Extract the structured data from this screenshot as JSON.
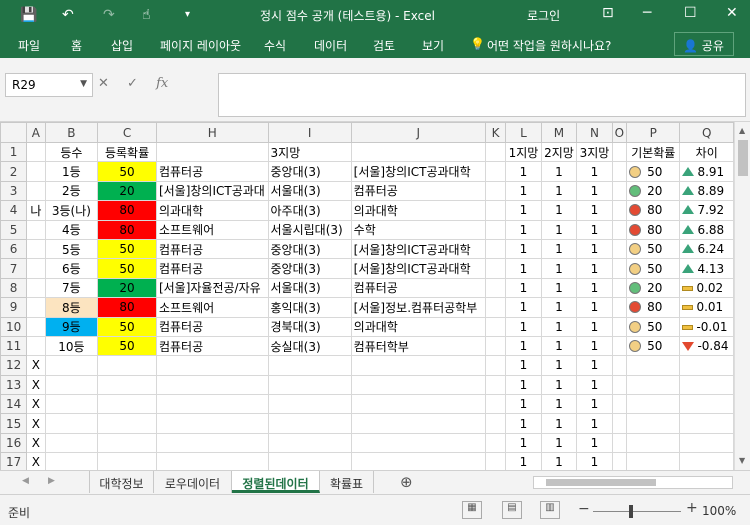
{
  "titlebar": {
    "title": "정시 점수 공개 (테스트용)  -  Excel",
    "login": "로그인",
    "save_icon": "💾",
    "undo_icon": "↶",
    "redo_icon": "↷",
    "touch_icon": "☝",
    "more_icon": "▾",
    "ribbon_options_icon": "⊡",
    "min_icon": "─",
    "max_icon": "☐",
    "close_icon": "✕"
  },
  "ribbon": {
    "tabs": [
      "파일",
      "홈",
      "삽입",
      "페이지 레이아웃",
      "수식",
      "데이터",
      "검토",
      "보기"
    ],
    "tell_me": "어떤 작업을 원하시나요?",
    "tell_me_icon": "💡",
    "share": "공유",
    "share_icon": "👤"
  },
  "formula": {
    "namebox": "R29",
    "dropdown_icon": "▼",
    "cancel_icon": "✕",
    "enter_icon": "✓",
    "fx_icon": "fx",
    "value": ""
  },
  "sheet": {
    "columns": [
      "A",
      "B",
      "C",
      "H",
      "I",
      "J",
      "K",
      "L",
      "M",
      "N",
      "O",
      "P",
      "Q"
    ],
    "rows": [
      {
        "num": "1",
        "A": "",
        "B": "등수",
        "C": "등록확률",
        "H": "",
        "I": "3지망",
        "J": "",
        "K": "",
        "L": "1지망",
        "M": "2지망",
        "N": "3지망",
        "O": "",
        "P": "기본확률",
        "Q": "차이"
      },
      {
        "num": "2",
        "A": "",
        "B": "1등",
        "C": "50",
        "H": "컴퓨터공",
        "I": "중앙대(3)",
        "J": "[서울]창의ICT공과대학",
        "K": "",
        "L": "1",
        "M": "1",
        "N": "1",
        "O": "",
        "P": "50",
        "Q": "8.91"
      },
      {
        "num": "3",
        "A": "",
        "B": "2등",
        "C": "20",
        "H": "[서울]창의ICT공과대",
        "I": "서울대(3)",
        "J": "컴퓨터공",
        "K": "",
        "L": "1",
        "M": "1",
        "N": "1",
        "O": "",
        "P": "20",
        "Q": "8.89"
      },
      {
        "num": "4",
        "A": "나",
        "B": "3등(나)",
        "C": "80",
        "H": "의과대학",
        "I": "아주대(3)",
        "J": "의과대학",
        "K": "",
        "L": "1",
        "M": "1",
        "N": "1",
        "O": "",
        "P": "80",
        "Q": "7.92"
      },
      {
        "num": "5",
        "A": "",
        "B": "4등",
        "C": "80",
        "H": "소프트웨어",
        "I": "서울시립대(3)",
        "J": "수학",
        "K": "",
        "L": "1",
        "M": "1",
        "N": "1",
        "O": "",
        "P": "80",
        "Q": "6.88"
      },
      {
        "num": "6",
        "A": "",
        "B": "5등",
        "C": "50",
        "H": "컴퓨터공",
        "I": "중앙대(3)",
        "J": "[서울]창의ICT공과대학",
        "K": "",
        "L": "1",
        "M": "1",
        "N": "1",
        "O": "",
        "P": "50",
        "Q": "6.24"
      },
      {
        "num": "7",
        "A": "",
        "B": "6등",
        "C": "50",
        "H": "컴퓨터공",
        "I": "중앙대(3)",
        "J": "[서울]창의ICT공과대학",
        "K": "",
        "L": "1",
        "M": "1",
        "N": "1",
        "O": "",
        "P": "50",
        "Q": "4.13"
      },
      {
        "num": "8",
        "A": "",
        "B": "7등",
        "C": "20",
        "H": "[서울]자율전공/자유",
        "I": "서울대(3)",
        "J": "컴퓨터공",
        "K": "",
        "L": "1",
        "M": "1",
        "N": "1",
        "O": "",
        "P": "20",
        "Q": "0.02"
      },
      {
        "num": "9",
        "A": "",
        "B": "8등",
        "C": "80",
        "H": "소프트웨어",
        "I": "홍익대(3)",
        "J": "[서울]정보.컴퓨터공학부",
        "K": "",
        "L": "1",
        "M": "1",
        "N": "1",
        "O": "",
        "P": "80",
        "Q": "0.01"
      },
      {
        "num": "10",
        "A": "",
        "B": "9등",
        "C": "50",
        "H": "컴퓨터공",
        "I": "경북대(3)",
        "J": "의과대학",
        "K": "",
        "L": "1",
        "M": "1",
        "N": "1",
        "O": "",
        "P": "50",
        "Q": "-0.01"
      },
      {
        "num": "11",
        "A": "",
        "B": "10등",
        "C": "50",
        "H": "컴퓨터공",
        "I": "숭실대(3)",
        "J": "컴퓨터학부",
        "K": "",
        "L": "1",
        "M": "1",
        "N": "1",
        "O": "",
        "P": "50",
        "Q": "-0.84"
      },
      {
        "num": "12",
        "A": "X",
        "B": "",
        "C": "",
        "H": "",
        "I": "",
        "J": "",
        "K": "",
        "L": "1",
        "M": "1",
        "N": "1",
        "O": "",
        "P": "",
        "Q": ""
      },
      {
        "num": "13",
        "A": "X",
        "B": "",
        "C": "",
        "H": "",
        "I": "",
        "J": "",
        "K": "",
        "L": "1",
        "M": "1",
        "N": "1",
        "O": "",
        "P": "",
        "Q": ""
      },
      {
        "num": "14",
        "A": "X",
        "B": "",
        "C": "",
        "H": "",
        "I": "",
        "J": "",
        "K": "",
        "L": "1",
        "M": "1",
        "N": "1",
        "O": "",
        "P": "",
        "Q": ""
      },
      {
        "num": "15",
        "A": "X",
        "B": "",
        "C": "",
        "H": "",
        "I": "",
        "J": "",
        "K": "",
        "L": "1",
        "M": "1",
        "N": "1",
        "O": "",
        "P": "",
        "Q": ""
      },
      {
        "num": "16",
        "A": "X",
        "B": "",
        "C": "",
        "H": "",
        "I": "",
        "J": "",
        "K": "",
        "L": "1",
        "M": "1",
        "N": "1",
        "O": "",
        "P": "",
        "Q": ""
      },
      {
        "num": "17",
        "A": "X",
        "B": "",
        "C": "",
        "H": "",
        "I": "",
        "J": "",
        "K": "",
        "L": "1",
        "M": "1",
        "N": "1",
        "O": "",
        "P": "",
        "Q": ""
      }
    ]
  },
  "colors": {
    "excel_green": "#217346",
    "yellow": "#ffff00",
    "green": "#00b050",
    "red": "#ff0000",
    "light_orange": "#fce4c0",
    "cyan": "#00b0f0",
    "dot_yellow": "#f2cf84",
    "dot_green": "#63be7b",
    "dot_red": "#e34a33"
  },
  "sheet_tabs": [
    "대학정보",
    "로우데이터",
    "정렬된데이터",
    "확률표"
  ],
  "active_sheet": "정렬된데이터",
  "add_sheet_icon": "⊕",
  "status": {
    "ready": "준비",
    "zoom": "100%"
  }
}
